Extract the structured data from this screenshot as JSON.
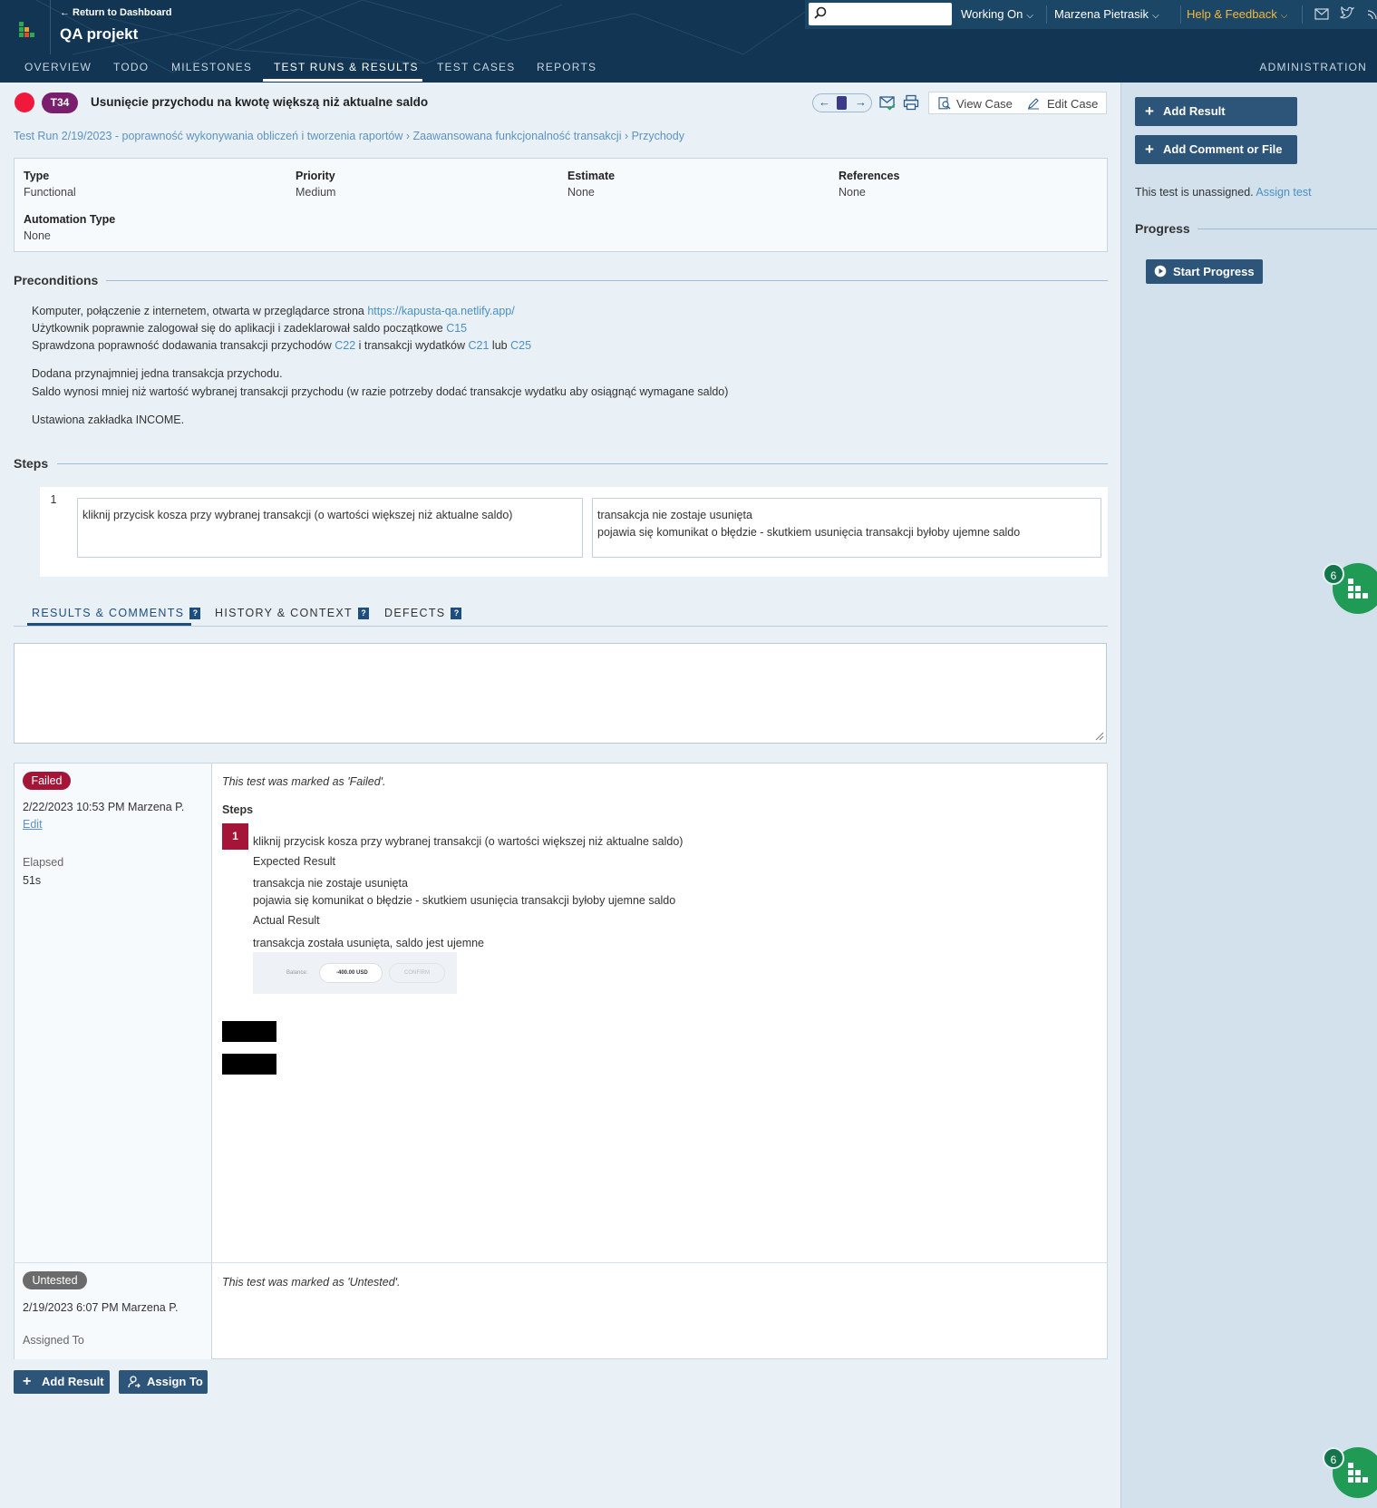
{
  "header": {
    "return_link": "← Return to Dashboard",
    "project_title": "QA projekt",
    "search_placeholder": "",
    "working_on": "Working On",
    "user_name": "Marzena Pietrasik",
    "help_feedback": "Help & Feedback",
    "help_color": "#f5b93a",
    "nav_tabs": [
      "OVERVIEW",
      "TODO",
      "MILESTONES",
      "TEST RUNS & RESULTS",
      "TEST CASES",
      "REPORTS"
    ],
    "active_tab": "TEST RUNS & RESULTS",
    "admin": "ADMINISTRATION",
    "icons": [
      "search-icon",
      "mail-icon",
      "twitter-icon",
      "rss-icon"
    ]
  },
  "test": {
    "status_color": "#f0193c",
    "id": "T34",
    "title": "Usunięcie przychodu na kwotę większą niż aktualne saldo",
    "view_case": "View Case",
    "edit_case": "Edit Case",
    "breadcrumb": "Test Run 2/19/2023 - poprawność wykonywania obliczeń i tworzenia raportów › Zaawansowana funkcjonalność transakcji › Przychody"
  },
  "info": {
    "type_label": "Type",
    "type_value": "Functional",
    "priority_label": "Priority",
    "priority_value": "Medium",
    "estimate_label": "Estimate",
    "estimate_value": "None",
    "references_label": "References",
    "references_value": "None",
    "automation_label": "Automation Type",
    "automation_value": "None"
  },
  "preconditions": {
    "heading": "Preconditions",
    "line1_text": "Komputer, połączenie z internetem, otwarta w przeglądarce strona ",
    "line1_link": "https://kapusta-qa.netlify.app/",
    "line2_text": "Użytkownik poprawnie zalogował się do aplikacji i zadeklarował saldo początkowe ",
    "line2_link": "C15",
    "line3_text": "Sprawdzona poprawność dodawania transakcji przychodów ",
    "line3_link1": "C22",
    "line3_mid": " i transakcji wydatków ",
    "line3_link2": "C21",
    "line3_mid2": " lub ",
    "line3_link3": "C25",
    "line4": "Dodana przynajmniej jedna transakcja przychodu.",
    "line5": "Saldo wynosi mniej niż wartość wybranej transakcji przychodu (w razie potrzeby dodać transakcje wydatku aby osiągnąć wymagane saldo)",
    "line6": "Ustawiona zakładka INCOME."
  },
  "steps": {
    "heading": "Steps",
    "number": "1",
    "action": "kliknij przycisk kosza przy wybranej transakcji (o wartości większej niż aktualne saldo)",
    "expected_line1": "transakcja nie zostaje usunięta",
    "expected_line2": "pojawia się komunikat o błędzie - skutkiem usunięcia transakcji byłoby ujemne saldo"
  },
  "tabs": {
    "results": "RESULTS & COMMENTS",
    "history": "HISTORY & CONTEXT",
    "defects": "DEFECTS",
    "help_mark": "?"
  },
  "comment": {
    "placeholder": ""
  },
  "results": [
    {
      "status": "Failed",
      "status_color": "#a51538",
      "date_user": "2/22/2023 10:53 PM Marzena P.",
      "edit": "Edit",
      "elapsed_label": "Elapsed",
      "elapsed_value": "51s",
      "message": "This test was marked as 'Failed'.",
      "steps_label": "Steps",
      "step_number": "1",
      "step_action": "kliknij przycisk kosza przy wybranej transakcji (o wartości większej niż aktualne saldo)",
      "expected_label": "Expected Result",
      "expected_line1": "transakcja nie zostaje usunięta",
      "expected_line2": "pojawia się komunikat o błędzie - skutkiem usunięcia transakcji byłoby ujemne saldo",
      "actual_label": "Actual Result",
      "actual_text": "transakcja została usunięta, saldo jest ujemne",
      "thumb_balance": "Balance:",
      "thumb_value": "-400.00 USD",
      "thumb_confirm": "CONFIRM"
    },
    {
      "status": "Untested",
      "status_color": "#6b6b6b",
      "date_user": "2/19/2023 6:07 PM Marzena P.",
      "assigned_label": "Assigned To",
      "message": "This test was marked as 'Untested'."
    }
  ],
  "bottom": {
    "add_result": "Add Result",
    "assign_to": "Assign To"
  },
  "sidebar": {
    "add_result": "Add Result",
    "add_comment": "Add Comment or File",
    "unassigned_text": "This test is unassigned.",
    "assign_link": "Assign test",
    "progress_heading": "Progress",
    "start_progress": "Start Progress"
  },
  "floating": {
    "count": "6"
  }
}
